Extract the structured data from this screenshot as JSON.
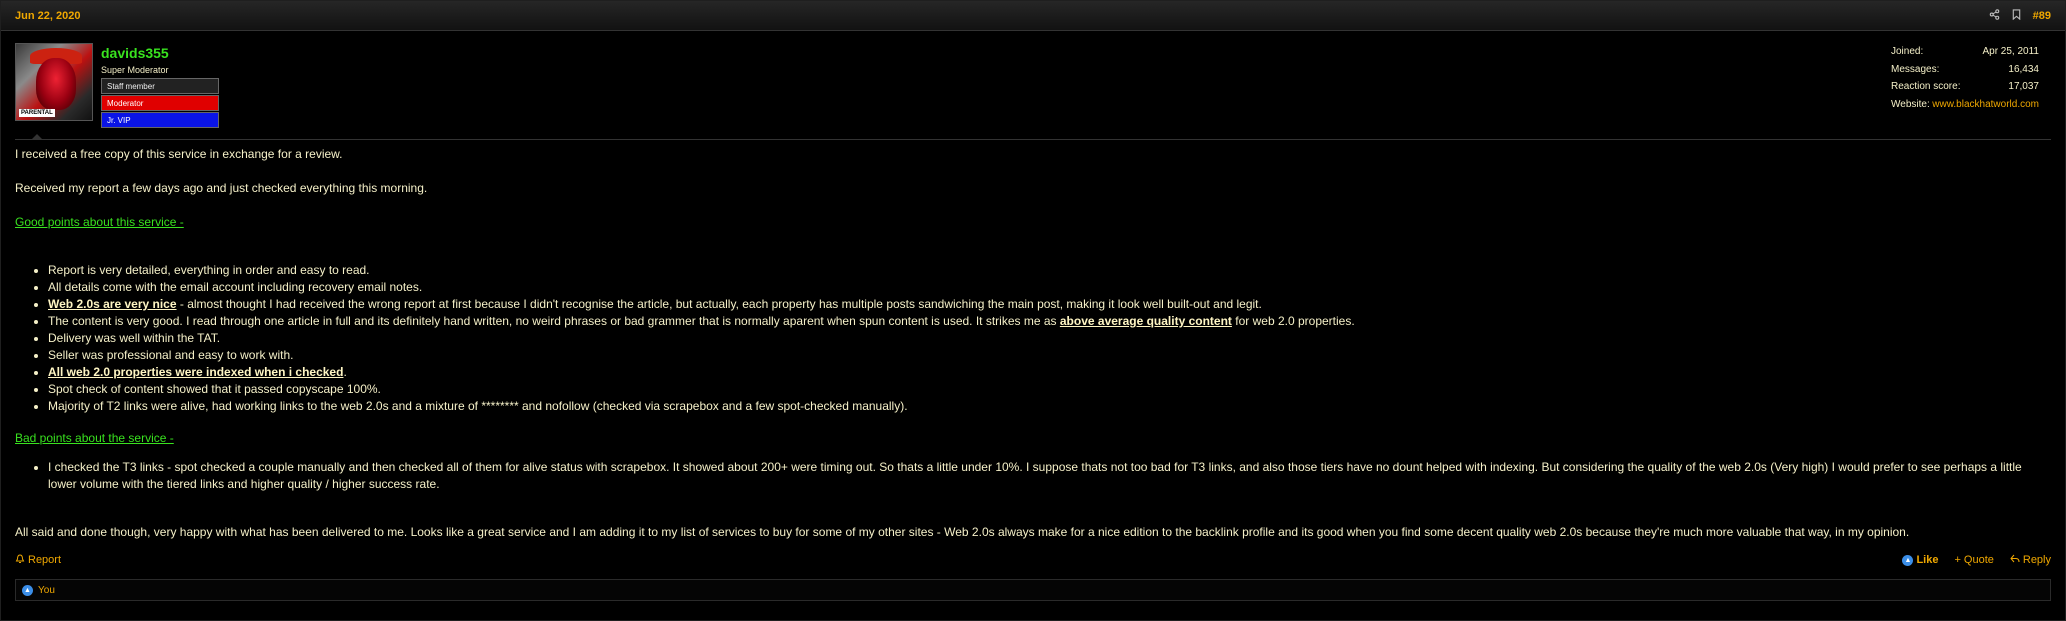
{
  "header": {
    "date": "Jun 22, 2020",
    "share_icon": "share-icon",
    "bookmark_icon": "bookmark-icon",
    "post_number": "#89"
  },
  "user": {
    "avatar_icon": "user-avatar-image",
    "name": "davids355",
    "title": "Super Moderator",
    "banners": [
      "Staff member",
      "Moderator",
      "Jr. VIP"
    ],
    "avatar_tag": "PARENTAL"
  },
  "stats": {
    "joined_label": "Joined:",
    "joined_value": "Apr 25, 2011",
    "messages_label": "Messages:",
    "messages_value": "16,434",
    "reaction_label": "Reaction score:",
    "reaction_value": "17,037",
    "website_label": "Website:",
    "website_value": "www.blackhatworld.com"
  },
  "body": {
    "p1": "I received a free copy of this service in exchange for a review.",
    "p2": "Received my report a few days ago and just checked everything this morning.",
    "good_heading": "Good points about this service -",
    "good_points": {
      "g1": "Report is very detailed, everything in order and easy to read.",
      "g2": "All details come with the email account including recovery email notes.",
      "g3_bold": "Web 2.0s are very nice",
      "g3_rest": " - almost thought I had received the wrong report at first because I didn't recognise the article, but actually, each property has multiple posts sandwiching the main post, making it look well built-out and legit.",
      "g4_start": "The content is very good. I read through one article in full and its definitely hand written, no weird phrases or bad grammer that is normally aparent when spun content is used. It strikes me as ",
      "g4_bold": "above average quality content",
      "g4_end": " for web 2.0 properties.",
      "g5": "Delivery was well within the TAT.",
      "g6": "Seller was professional and easy to work with.",
      "g7_bold": "All web 2.0 properties were indexed when i checked",
      "g7_end": ".",
      "g8": "Spot check of content showed that it passed copyscape 100%.",
      "g9": "Majority of T2 links were alive, had working links to the web 2.0s and a mixture of ******** and nofollow (checked via scrapebox and a few spot-checked manually)."
    },
    "bad_heading": "Bad points about the service -",
    "bad_points": {
      "b1": "I checked the T3 links - spot checked a couple manually and then checked all of them for alive status with scrapebox. It showed about 200+ were timing out. So thats a little under 10%. I suppose thats not too bad for T3 links, and also those tiers have no dount helped with indexing. But considering the quality of the web 2.0s (Very high) I would prefer to see perhaps a little lower volume with the tiered links and higher quality / higher success rate."
    },
    "conclusion": "All said and done though, very happy with what has been delivered to me. Looks like a great service and I am adding it to my list of services to buy for some of my other sites - Web 2.0s always make for a nice edition to the backlink profile and its good when you find some decent quality web 2.0s because they're much more valuable that way, in my opinion."
  },
  "footer": {
    "report_label": "Report",
    "like_label": "Like",
    "quote_label": "Quote",
    "reply_label": "Reply"
  },
  "reactions": {
    "user": "You"
  }
}
